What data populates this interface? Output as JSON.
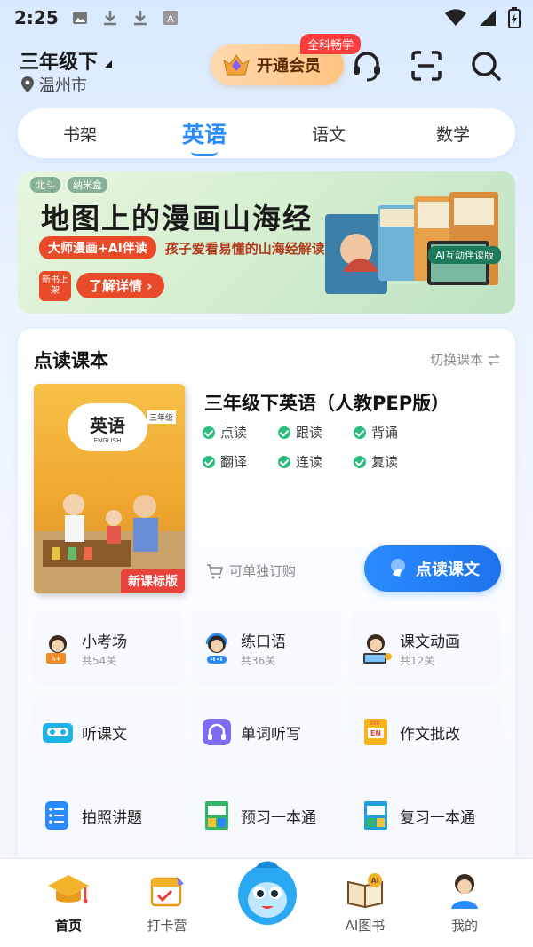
{
  "status_bar": {
    "time": "2:25"
  },
  "header": {
    "grade": "三年级下",
    "city": "温州市",
    "vip_label": "开通会员",
    "vip_badge": "全科畅学"
  },
  "tabs": [
    {
      "label": "书架",
      "active": false
    },
    {
      "label": "英语",
      "active": true
    },
    {
      "label": "语文",
      "active": false
    },
    {
      "label": "数学",
      "active": false
    }
  ],
  "banner": {
    "brand_a": "北斗",
    "brand_b": "纳米盒",
    "title": "地图上的漫画山海经",
    "tag": "大师漫画+AI伴读",
    "subtitle": "孩子爱看易懂的山海经解读",
    "new_tag": "新书上架",
    "more": "了解详情",
    "ai_label": "AI互动伴读版"
  },
  "reading_card": {
    "title": "点读课本",
    "switch_label": "切换课本",
    "book": {
      "cover_title": "英语",
      "cover_sub": "ENGLISH",
      "cover_grade": "三年级",
      "new_label": "新课标版",
      "name": "三年级下英语（人教PEP版）"
    },
    "features": [
      "点读",
      "跟读",
      "背诵",
      "翻译",
      "连读",
      "复读"
    ],
    "buy_alone": "可单独订购",
    "read_button": "点读课文",
    "tools": [
      {
        "name": "小考场",
        "sub": "共54关",
        "icon": "exam-girl-icon"
      },
      {
        "name": "练口语",
        "sub": "共36关",
        "icon": "speaking-boy-icon"
      },
      {
        "name": "课文动画",
        "sub": "共12关",
        "icon": "animation-girl-icon"
      },
      {
        "name": "听课文",
        "sub": "",
        "icon": "cassette-icon"
      },
      {
        "name": "单词听写",
        "sub": "",
        "icon": "headphone-icon"
      },
      {
        "name": "作文批改",
        "sub": "",
        "icon": "essay-en-icon"
      },
      {
        "name": "拍照讲题",
        "sub": "",
        "icon": "photo-list-icon"
      },
      {
        "name": "预习一本通",
        "sub": "",
        "icon": "preview-book-icon"
      },
      {
        "name": "复习一本通",
        "sub": "",
        "icon": "review-book-icon"
      }
    ]
  },
  "bottom_nav": [
    {
      "label": "首页",
      "active": true
    },
    {
      "label": "打卡营",
      "active": false
    },
    {
      "label": "",
      "active": false
    },
    {
      "label": "AI图书",
      "active": false
    },
    {
      "label": "我的",
      "active": false
    }
  ],
  "colors": {
    "accent": "#2a8bff",
    "check": "#2bbd7e",
    "banner_red": "#e94a2a"
  }
}
